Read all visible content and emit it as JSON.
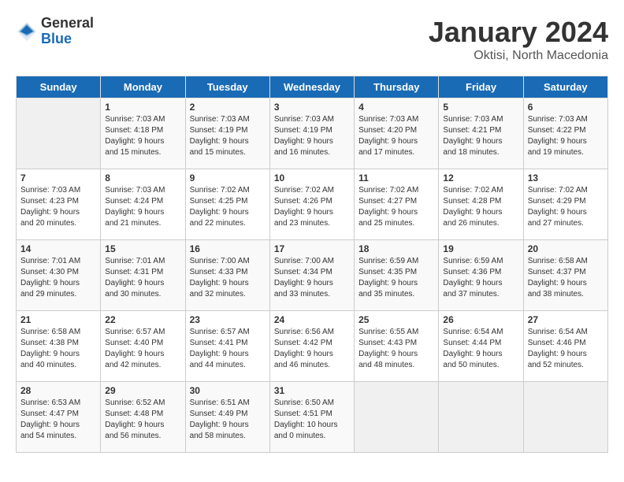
{
  "header": {
    "logo_general": "General",
    "logo_blue": "Blue",
    "title": "January 2024",
    "subtitle": "Oktisi, North Macedonia"
  },
  "calendar": {
    "days_of_week": [
      "Sunday",
      "Monday",
      "Tuesday",
      "Wednesday",
      "Thursday",
      "Friday",
      "Saturday"
    ],
    "weeks": [
      [
        {
          "day": "",
          "info": ""
        },
        {
          "day": "1",
          "info": "Sunrise: 7:03 AM\nSunset: 4:18 PM\nDaylight: 9 hours\nand 15 minutes."
        },
        {
          "day": "2",
          "info": "Sunrise: 7:03 AM\nSunset: 4:19 PM\nDaylight: 9 hours\nand 15 minutes."
        },
        {
          "day": "3",
          "info": "Sunrise: 7:03 AM\nSunset: 4:19 PM\nDaylight: 9 hours\nand 16 minutes."
        },
        {
          "day": "4",
          "info": "Sunrise: 7:03 AM\nSunset: 4:20 PM\nDaylight: 9 hours\nand 17 minutes."
        },
        {
          "day": "5",
          "info": "Sunrise: 7:03 AM\nSunset: 4:21 PM\nDaylight: 9 hours\nand 18 minutes."
        },
        {
          "day": "6",
          "info": "Sunrise: 7:03 AM\nSunset: 4:22 PM\nDaylight: 9 hours\nand 19 minutes."
        }
      ],
      [
        {
          "day": "7",
          "info": "Sunrise: 7:03 AM\nSunset: 4:23 PM\nDaylight: 9 hours\nand 20 minutes."
        },
        {
          "day": "8",
          "info": "Sunrise: 7:03 AM\nSunset: 4:24 PM\nDaylight: 9 hours\nand 21 minutes."
        },
        {
          "day": "9",
          "info": "Sunrise: 7:02 AM\nSunset: 4:25 PM\nDaylight: 9 hours\nand 22 minutes."
        },
        {
          "day": "10",
          "info": "Sunrise: 7:02 AM\nSunset: 4:26 PM\nDaylight: 9 hours\nand 23 minutes."
        },
        {
          "day": "11",
          "info": "Sunrise: 7:02 AM\nSunset: 4:27 PM\nDaylight: 9 hours\nand 25 minutes."
        },
        {
          "day": "12",
          "info": "Sunrise: 7:02 AM\nSunset: 4:28 PM\nDaylight: 9 hours\nand 26 minutes."
        },
        {
          "day": "13",
          "info": "Sunrise: 7:02 AM\nSunset: 4:29 PM\nDaylight: 9 hours\nand 27 minutes."
        }
      ],
      [
        {
          "day": "14",
          "info": "Sunrise: 7:01 AM\nSunset: 4:30 PM\nDaylight: 9 hours\nand 29 minutes."
        },
        {
          "day": "15",
          "info": "Sunrise: 7:01 AM\nSunset: 4:31 PM\nDaylight: 9 hours\nand 30 minutes."
        },
        {
          "day": "16",
          "info": "Sunrise: 7:00 AM\nSunset: 4:33 PM\nDaylight: 9 hours\nand 32 minutes."
        },
        {
          "day": "17",
          "info": "Sunrise: 7:00 AM\nSunset: 4:34 PM\nDaylight: 9 hours\nand 33 minutes."
        },
        {
          "day": "18",
          "info": "Sunrise: 6:59 AM\nSunset: 4:35 PM\nDaylight: 9 hours\nand 35 minutes."
        },
        {
          "day": "19",
          "info": "Sunrise: 6:59 AM\nSunset: 4:36 PM\nDaylight: 9 hours\nand 37 minutes."
        },
        {
          "day": "20",
          "info": "Sunrise: 6:58 AM\nSunset: 4:37 PM\nDaylight: 9 hours\nand 38 minutes."
        }
      ],
      [
        {
          "day": "21",
          "info": "Sunrise: 6:58 AM\nSunset: 4:38 PM\nDaylight: 9 hours\nand 40 minutes."
        },
        {
          "day": "22",
          "info": "Sunrise: 6:57 AM\nSunset: 4:40 PM\nDaylight: 9 hours\nand 42 minutes."
        },
        {
          "day": "23",
          "info": "Sunrise: 6:57 AM\nSunset: 4:41 PM\nDaylight: 9 hours\nand 44 minutes."
        },
        {
          "day": "24",
          "info": "Sunrise: 6:56 AM\nSunset: 4:42 PM\nDaylight: 9 hours\nand 46 minutes."
        },
        {
          "day": "25",
          "info": "Sunrise: 6:55 AM\nSunset: 4:43 PM\nDaylight: 9 hours\nand 48 minutes."
        },
        {
          "day": "26",
          "info": "Sunrise: 6:54 AM\nSunset: 4:44 PM\nDaylight: 9 hours\nand 50 minutes."
        },
        {
          "day": "27",
          "info": "Sunrise: 6:54 AM\nSunset: 4:46 PM\nDaylight: 9 hours\nand 52 minutes."
        }
      ],
      [
        {
          "day": "28",
          "info": "Sunrise: 6:53 AM\nSunset: 4:47 PM\nDaylight: 9 hours\nand 54 minutes."
        },
        {
          "day": "29",
          "info": "Sunrise: 6:52 AM\nSunset: 4:48 PM\nDaylight: 9 hours\nand 56 minutes."
        },
        {
          "day": "30",
          "info": "Sunrise: 6:51 AM\nSunset: 4:49 PM\nDaylight: 9 hours\nand 58 minutes."
        },
        {
          "day": "31",
          "info": "Sunrise: 6:50 AM\nSunset: 4:51 PM\nDaylight: 10 hours\nand 0 minutes."
        },
        {
          "day": "",
          "info": ""
        },
        {
          "day": "",
          "info": ""
        },
        {
          "day": "",
          "info": ""
        }
      ]
    ]
  }
}
